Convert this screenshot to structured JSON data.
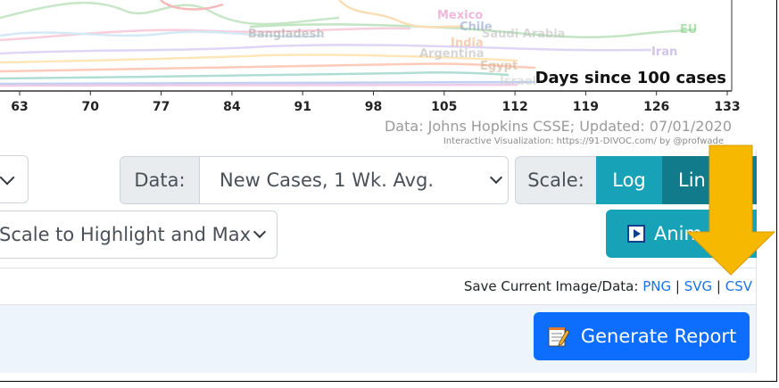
{
  "chart": {
    "x_axis_label": "Days since 100 cases",
    "x_ticks": [
      "63",
      "70",
      "77",
      "84",
      "91",
      "98",
      "105",
      "112",
      "119",
      "126",
      "133"
    ],
    "credit_line1": "Data: Johns Hopkins CSSE; Updated: 07/01/2020",
    "credit_line2": "Interactive Visualization: https://91-DIVOC.com/ by @profwade_",
    "country_labels": [
      "Mexico",
      "Chile",
      "Saudi Arabia",
      "EU",
      "Bangladesh",
      "Iran",
      "Argentina",
      "Egypt",
      "India",
      "Israel"
    ]
  },
  "controls": {
    "data_label": "Data:",
    "data_value": "New Cases, 1 Wk. Avg.",
    "scale_label": "Scale:",
    "scale_log": "Log",
    "scale_linear": "Lin",
    "yaxis_value": "Scale to Highlight and Max",
    "animate_label": "Anim"
  },
  "save": {
    "prefix": "Save Current Image/Data:",
    "png": "PNG",
    "svg": "SVG",
    "csv": "CSV",
    "sep": "|"
  },
  "report": {
    "button_label": "Generate Report"
  },
  "colors": {
    "primary": "#0d6efd",
    "teal": "#17a2b8",
    "teal_dark": "#117a8b",
    "arrow": "#f6b800"
  }
}
